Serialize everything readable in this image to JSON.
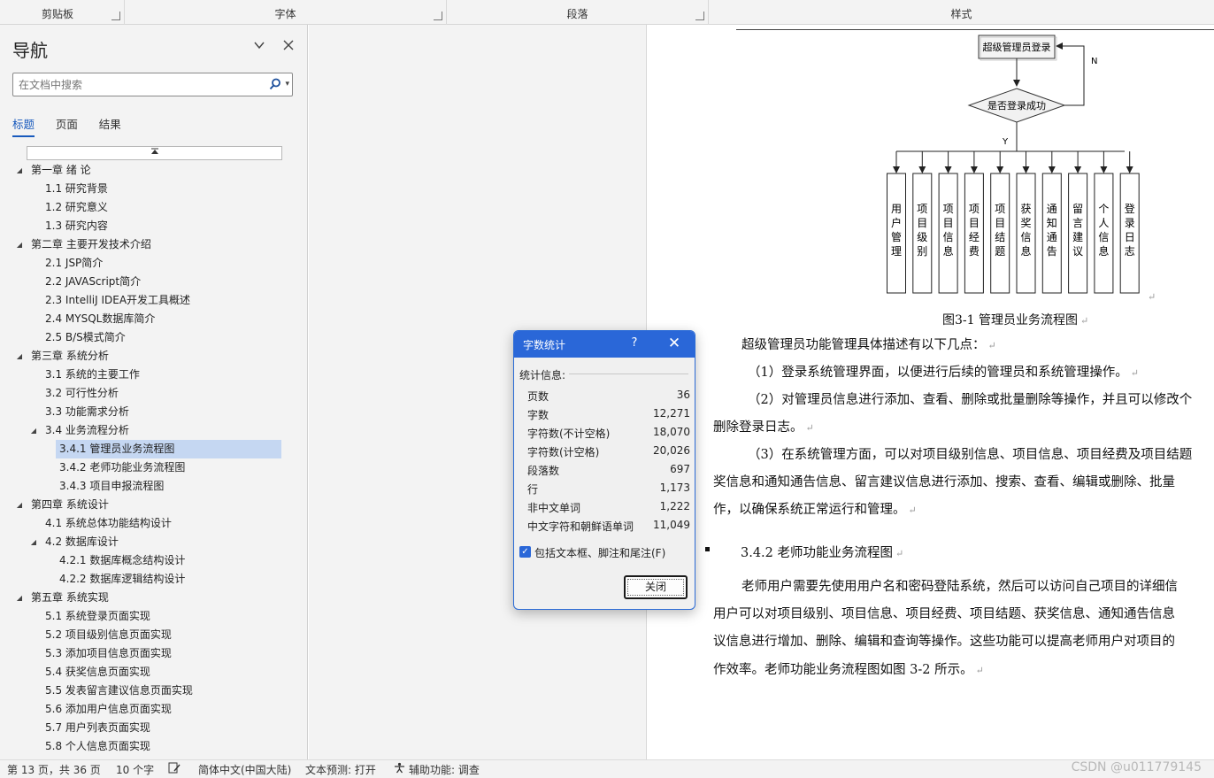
{
  "ribbon": {
    "groups": [
      "剪贴板",
      "字体",
      "段落",
      "样式"
    ]
  },
  "nav": {
    "title": "导航",
    "search_placeholder": "在文档中搜索",
    "tabs": [
      "标题",
      "页面",
      "结果"
    ],
    "outline": [
      {
        "level": 1,
        "text": "第一章 绪  论",
        "expanded": true
      },
      {
        "level": 2,
        "text": "1.1 研究背景"
      },
      {
        "level": 2,
        "text": "1.2 研究意义"
      },
      {
        "level": 2,
        "text": "1.3 研究内容"
      },
      {
        "level": 1,
        "text": "第二章 主要开发技术介绍",
        "expanded": true
      },
      {
        "level": 2,
        "text": "2.1 JSP简介"
      },
      {
        "level": 2,
        "text": "2.2 JAVAScript简介"
      },
      {
        "level": 2,
        "text": "2.3 IntelliJ IDEA开发工具概述"
      },
      {
        "level": 2,
        "text": "2.4 MYSQL数据库简介"
      },
      {
        "level": 2,
        "text": "2.5 B/S模式简介"
      },
      {
        "level": 1,
        "text": "第三章 系统分析",
        "expanded": true
      },
      {
        "level": 2,
        "text": "3.1 系统的主要工作"
      },
      {
        "level": 2,
        "text": "3.2 可行性分析"
      },
      {
        "level": 2,
        "text": "3.3 功能需求分析"
      },
      {
        "level": 2,
        "text": "3.4 业务流程分析",
        "expanded": true
      },
      {
        "level": 3,
        "text": "3.4.1 管理员业务流程图",
        "selected": true
      },
      {
        "level": 3,
        "text": "3.4.2 老师功能业务流程图"
      },
      {
        "level": 3,
        "text": "3.4.3 项目申报流程图"
      },
      {
        "level": 1,
        "text": "第四章 系统设计",
        "expanded": true
      },
      {
        "level": 2,
        "text": "4.1 系统总体功能结构设计"
      },
      {
        "level": 2,
        "text": "4.2 数据库设计",
        "expanded": true
      },
      {
        "level": 3,
        "text": "4.2.1 数据库概念结构设计"
      },
      {
        "level": 3,
        "text": "4.2.2 数据库逻辑结构设计"
      },
      {
        "level": 1,
        "text": "第五章 系统实现",
        "expanded": true
      },
      {
        "level": 2,
        "text": "5.1 系统登录页面实现"
      },
      {
        "level": 2,
        "text": "5.2 项目级别信息页面实现"
      },
      {
        "level": 2,
        "text": "5.3 添加项目信息页面实现"
      },
      {
        "level": 2,
        "text": "5.4 获奖信息页面实现"
      },
      {
        "level": 2,
        "text": "5.5 发表留言建议信息页面实现"
      },
      {
        "level": 2,
        "text": "5.6 添加用户信息页面实现"
      },
      {
        "level": 2,
        "text": "5.7 用户列表页面实现"
      },
      {
        "level": 2,
        "text": "5.8 个人信息页面实现"
      }
    ]
  },
  "document": {
    "flowchart": {
      "start": "超级管理员登录",
      "decision": "是否登录成功",
      "no_label": "N",
      "yes_label": "Y",
      "modules": [
        "用户管理",
        "项目级别",
        "项目信息",
        "项目经费",
        "项目结题",
        "获奖信息",
        "通知通告",
        "留言建议",
        "个人信息",
        "登录日志"
      ]
    },
    "caption": "图3-1 管理员业务流程图",
    "lines": [
      "超级管理员功能管理具体描述有以下几点：",
      "（1）登录系统管理界面，以便进行后续的管理员和系统管理操作。",
      "（2）对管理员信息进行添加、查看、删除或批量删除等操作，并且可以修改个",
      "删除登录日志。",
      "（3）在系统管理方面，可以对项目级别信息、项目信息、项目经费及项目结题",
      "奖信息和通知通告信息、留言建议信息进行添加、搜索、查看、编辑或删除、批量",
      "作，以确保系统正常运行和管理。"
    ],
    "heading": "3.4.2 老师功能业务流程图",
    "lines2": [
      "老师用户需要先使用用户名和密码登陆系统，然后可以访问自己项目的详细信",
      "用户可以对项目级别、项目信息、项目经费、项目结题、获奖信息、通知通告信息",
      "议信息进行增加、删除、编辑和查询等操作。这些功能可以提高老师用户对项目的",
      "作效率。老师功能业务流程图如图 3-2 所示。"
    ]
  },
  "dialog": {
    "title": "字数统计",
    "help": "?",
    "stats_label": "统计信息:",
    "stats": [
      {
        "key": "页数",
        "value": "36"
      },
      {
        "key": "字数",
        "value": "12,271"
      },
      {
        "key": "字符数(不计空格)",
        "value": "18,070"
      },
      {
        "key": "字符数(计空格)",
        "value": "20,026"
      },
      {
        "key": "段落数",
        "value": "697"
      },
      {
        "key": "行",
        "value": "1,173"
      },
      {
        "key": "非中文单词",
        "value": "1,222"
      },
      {
        "key": "中文字符和朝鲜语单词",
        "value": "11,049"
      }
    ],
    "checkbox_label": "包括文本框、脚注和尾注(F)",
    "checkbox_checked": true,
    "close_button": "关闭"
  },
  "statusbar": {
    "page": "第 13 页，共 36 页",
    "words": "10 个字",
    "language": "简体中文(中国大陆)",
    "prediction": "文本预测: 打开",
    "accessibility": "辅助功能: 调查",
    "watermark": "CSDN @u011779145"
  },
  "colors": {
    "accent": "#2a67d8",
    "selected": "#c5d7f2",
    "tab_active": "#185abd"
  }
}
